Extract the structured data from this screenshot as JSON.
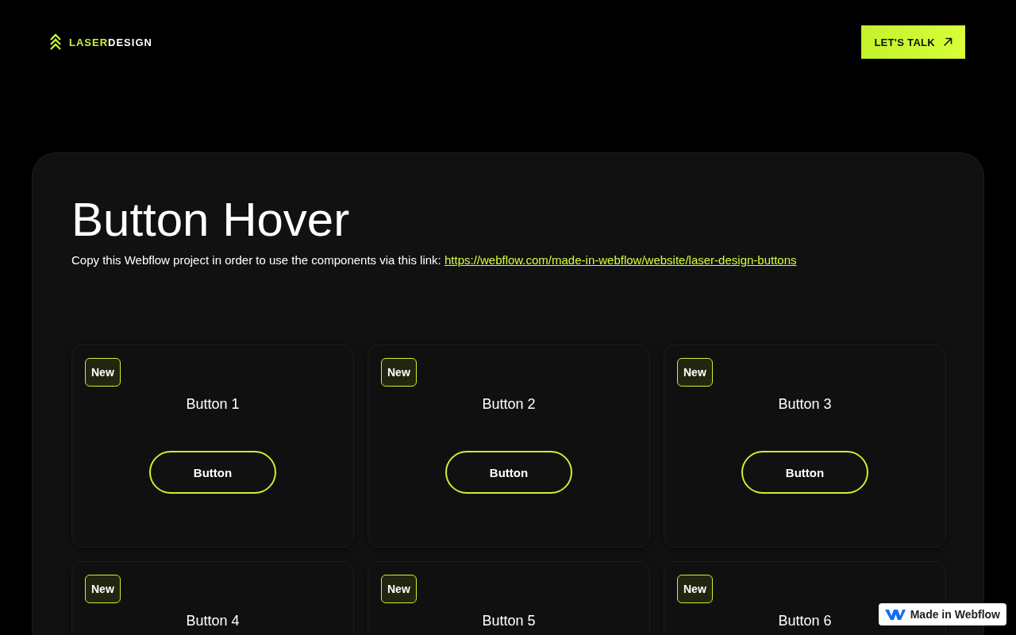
{
  "header": {
    "logo": {
      "accent": "LASER",
      "text": "DESIGN"
    },
    "cta": {
      "label": "LET'S TALK"
    }
  },
  "hero": {
    "title": "Button Hover",
    "intro": "Copy this Webflow project in order to use the components via this link:",
    "link": "https://webflow.com/made-in-webflow/website/laser-design-buttons"
  },
  "cards": [
    {
      "badge": "New",
      "title": "Button 1",
      "button": "Button"
    },
    {
      "badge": "New",
      "title": "Button 2",
      "button": "Button"
    },
    {
      "badge": "New",
      "title": "Button 3",
      "button": "Button"
    },
    {
      "badge": "New",
      "title": "Button 4"
    },
    {
      "badge": "New",
      "title": "Button 5"
    },
    {
      "badge": "New",
      "title": "Button 6"
    }
  ],
  "webflow_badge": {
    "label": "Made in Webflow"
  }
}
